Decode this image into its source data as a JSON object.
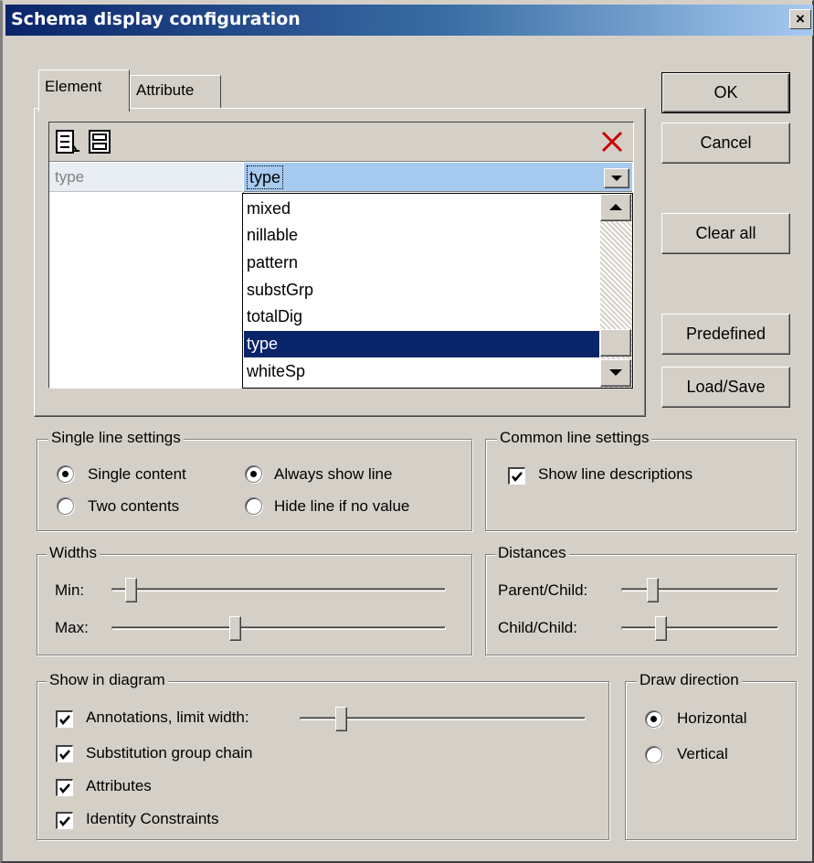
{
  "window": {
    "title": "Schema display configuration",
    "close_label": "×"
  },
  "tabs": [
    {
      "label": "Element",
      "active": true
    },
    {
      "label": "Attribute",
      "active": false
    }
  ],
  "grid": {
    "toolbar_icons": [
      "append-line-icon",
      "insert-line-icon",
      "delete-line-icon"
    ],
    "row": {
      "left_value": "type",
      "combo_value": "type"
    },
    "dropdown_options": [
      "mixed",
      "nillable",
      "pattern",
      "substGrp",
      "totalDig",
      "type",
      "whiteSp"
    ],
    "selected_option": "type"
  },
  "buttons": {
    "ok": "OK",
    "cancel": "Cancel",
    "clear_all": "Clear all",
    "predefined": "Predefined",
    "load_save": "Load/Save"
  },
  "single_line": {
    "title": "Single line settings",
    "single_content": "Single content",
    "two_contents": "Two contents",
    "always_show_line": "Always show line",
    "hide_line_if_no_value": "Hide line if no value",
    "selected_content": "Single content",
    "selected_line": "Always show line"
  },
  "common_line": {
    "title": "Common line settings",
    "show_line_descriptions": "Show line descriptions",
    "show_line_descriptions_checked": true
  },
  "widths": {
    "title": "Widths",
    "min_label": "Min:",
    "max_label": "Max:",
    "min_level": 0.06,
    "max_level": 0.38
  },
  "distances": {
    "title": "Distances",
    "parent_child_label": "Parent/Child:",
    "child_child_label": "Child/Child:",
    "parent_child_level": 0.2,
    "child_child_level": 0.25
  },
  "show_in_diagram": {
    "title": "Show in diagram",
    "annotations": "Annotations, limit width:",
    "substitution": "Substitution group chain",
    "attributes": "Attributes",
    "identity": "Identity Constraints",
    "annotations_checked": true,
    "substitution_checked": true,
    "attributes_checked": true,
    "identity_checked": true,
    "annotations_width_level": 0.15
  },
  "draw_direction": {
    "title": "Draw direction",
    "horizontal": "Horizontal",
    "vertical": "Vertical",
    "selected": "Horizontal"
  },
  "colors": {
    "title_start": "#0a246a",
    "title_end": "#a6caf0",
    "face": "#d4d0c8",
    "selection": "#0a246a",
    "combo_highlight": "#a6caf0",
    "delete_red": "#cc0000"
  }
}
